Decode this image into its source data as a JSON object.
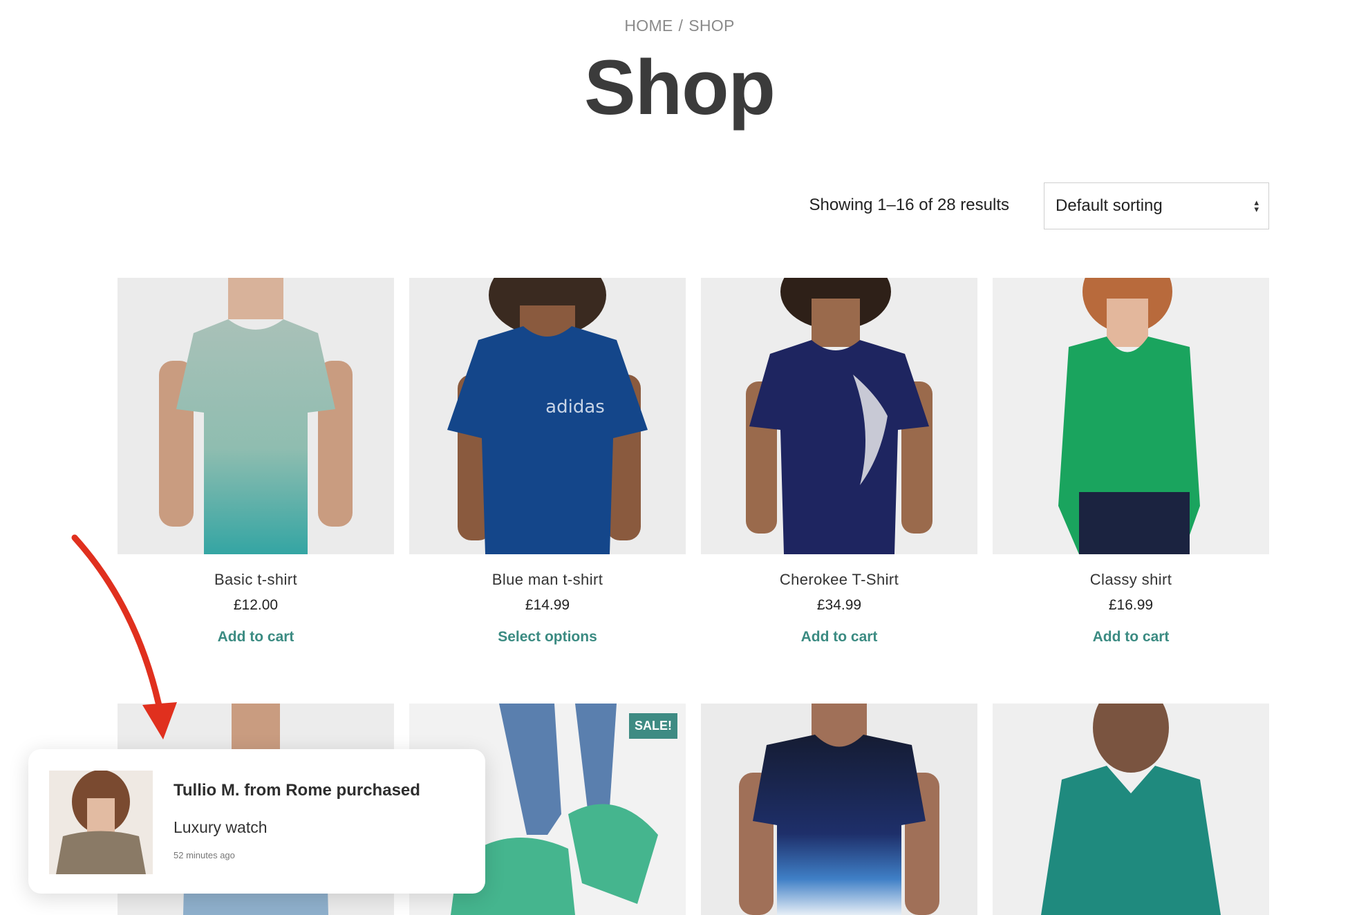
{
  "breadcrumb": {
    "home": "HOME",
    "separator": "/",
    "current": "SHOP"
  },
  "page_title": "Shop",
  "result_count": "Showing 1–16 of 28 results",
  "sorting": {
    "selected": "Default sorting"
  },
  "products": [
    {
      "name": "Basic t-shirt",
      "price": "£12.00",
      "action": "Add to cart"
    },
    {
      "name": "Blue man t-shirt",
      "price": "£14.99",
      "action": "Select options"
    },
    {
      "name": "Cherokee T-Shirt",
      "price": "£34.99",
      "action": "Add to cart"
    },
    {
      "name": "Classy shirt",
      "price": "£16.99",
      "action": "Add to cart"
    }
  ],
  "row2": {
    "sale_badge": "SALE!"
  },
  "notification": {
    "title": "Tullio M. from Rome purchased",
    "product": "Luxury watch",
    "time": "52 minutes ago"
  },
  "colors": {
    "accent": "#3b8b82",
    "sale_badge": "#3e8b83",
    "annotation_arrow": "#e0301e"
  }
}
